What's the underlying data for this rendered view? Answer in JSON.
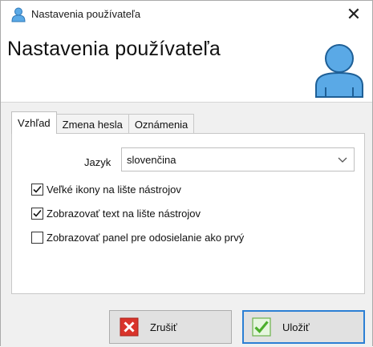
{
  "window": {
    "title": "Nastavenia používateľa",
    "close_glyph": "✕"
  },
  "header": {
    "title": "Nastavenia používateľa",
    "icon": "user-avatar-icon"
  },
  "tabs": [
    {
      "label": "Vzhľad",
      "active": true
    },
    {
      "label": "Zmena hesla",
      "active": false
    },
    {
      "label": "Oznámenia",
      "active": false
    }
  ],
  "appearance": {
    "language_label": "Jazyk",
    "language_value": "slovenčina",
    "options": [
      {
        "label": "Veľké ikony na lište nástrojov",
        "checked": true
      },
      {
        "label": "Zobrazovať text na lište nástrojov",
        "checked": true
      },
      {
        "label": "Zobrazovať panel pre odosielanie ako prvý",
        "checked": false
      }
    ]
  },
  "buttons": {
    "cancel_label": "Zrušiť",
    "save_label": "Uložiť"
  },
  "colors": {
    "accent": "#2b7fd4",
    "avatar_fill": "#5aa9e6",
    "cancel_red": "#d9342b",
    "save_green": "#4caf2c"
  }
}
